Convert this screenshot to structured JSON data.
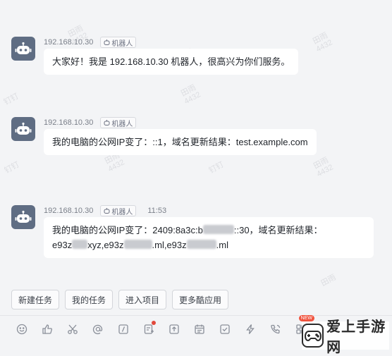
{
  "watermarks": [
    {
      "t1": "田雨",
      "t2": "4432"
    },
    {
      "t1": "钉钉",
      "t2": ""
    },
    {
      "t1": "田雨",
      "t2": "4432"
    },
    {
      "t1": "钉钉",
      "t2": ""
    },
    {
      "t1": "田雨",
      "t2": "4432"
    },
    {
      "t1": "田雨",
      "t2": "4432"
    },
    {
      "t1": "钉钉",
      "t2": ""
    },
    {
      "t1": "田雨",
      "t2": "4432"
    },
    {
      "t1": "钉钉",
      "t2": ""
    },
    {
      "t1": "田雨",
      "t2": "4432"
    }
  ],
  "messages": [
    {
      "sender_ip": "192.168.10.30",
      "tag": "机器人",
      "time": "",
      "text": "大家好！我是 192.168.10.30 机器人，很高兴为你们服务。"
    },
    {
      "sender_ip": "192.168.10.30",
      "tag": "机器人",
      "time": "",
      "text": "我的电脑的公网IP变了：::1，域名更新结果：test.example.com"
    },
    {
      "sender_ip": "192.168.10.30",
      "tag": "机器人",
      "time": "11:53",
      "line1_a": "我的电脑的公网IP变了：2409:8a3c:b",
      "line1_b": "::30，域名更新结果：",
      "line2_a": "e93z",
      "line2_b": "xyz,e93z",
      "line2_c": ".ml,e93z",
      "line2_d": ".ml"
    }
  ],
  "quick_actions": [
    "新建任务",
    "我的任务",
    "进入项目",
    "更多酷应用"
  ],
  "toolbar": {
    "icons": [
      "emoji-icon",
      "thumbs-up-icon",
      "scissors-icon",
      "mention-icon",
      "slash-command-icon",
      "ding-icon",
      "upload-icon",
      "calendar-icon",
      "task-check-icon",
      "lightning-icon",
      "voice-call-icon",
      "apps-icon"
    ],
    "new_badge": "NEW"
  },
  "brand": {
    "text": "爱上手游网"
  },
  "colors": {
    "avatar": "#5f6d83",
    "bubble": "#ffffff",
    "background": "#f3f4f6",
    "badge": "#f0533e"
  }
}
